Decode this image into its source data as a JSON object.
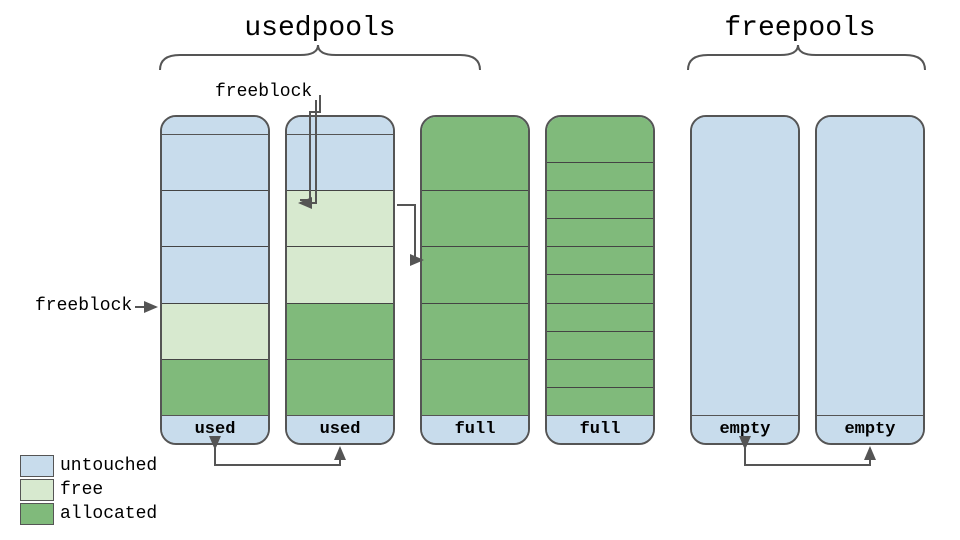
{
  "titles": {
    "usedpools": "usedpools",
    "freepools": "freepools"
  },
  "labels": {
    "freeblock_left": "freeblock",
    "freeblock_top": "freeblock"
  },
  "legend": {
    "untouched": "untouched",
    "free": "free",
    "allocated": "allocated"
  },
  "pools": [
    {
      "footer": "used",
      "cells": [
        "untouched",
        "untouched",
        "untouched",
        "free",
        "alloc"
      ],
      "bg": "untouched"
    },
    {
      "footer": "used",
      "cells": [
        "untouched",
        "free",
        "free",
        "alloc",
        "alloc"
      ],
      "bg": "untouched"
    },
    {
      "footer": "full",
      "cells": [
        "alloc",
        "alloc",
        "alloc",
        "alloc",
        "alloc"
      ],
      "bg": "untouched"
    },
    {
      "footer": "full",
      "cells": [
        "alloc",
        "alloc",
        "alloc",
        "alloc",
        "alloc",
        "alloc",
        "alloc",
        "alloc",
        "alloc",
        "alloc"
      ],
      "bg": "untouched"
    },
    {
      "footer": "empty",
      "cells": [],
      "bg": "untouched"
    },
    {
      "footer": "empty",
      "cells": [],
      "bg": "untouched"
    }
  ],
  "colors": {
    "untouched": "#c8dcec",
    "free": "#d7e9cf",
    "allocated": "#80ba7b",
    "stroke": "#555"
  }
}
